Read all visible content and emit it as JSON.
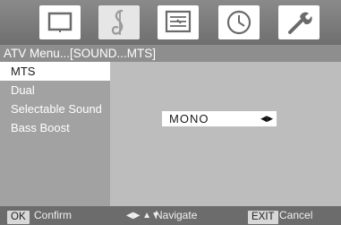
{
  "icon_bar": {
    "icons": [
      "picture-icon",
      "sound-icon",
      "channel-icon",
      "time-icon",
      "setup-icon"
    ],
    "selected": "sound-icon"
  },
  "title": "ATV Menu...[SOUND...MTS]",
  "menu": {
    "items": [
      {
        "label": "MTS",
        "selected": true
      },
      {
        "label": "Dual",
        "selected": false
      },
      {
        "label": "Selectable Sound",
        "selected": false
      },
      {
        "label": "Bass Boost",
        "selected": false
      }
    ]
  },
  "panel": {
    "value": "MONO",
    "arrows": "◀▶"
  },
  "hints": {
    "confirm_key": "OK",
    "confirm_label": "Confirm",
    "navigate_glyph": "◀▶ ▲▼",
    "navigate_label": "Navigate",
    "exit_key": "EXIT",
    "exit_label": "Cancel"
  }
}
